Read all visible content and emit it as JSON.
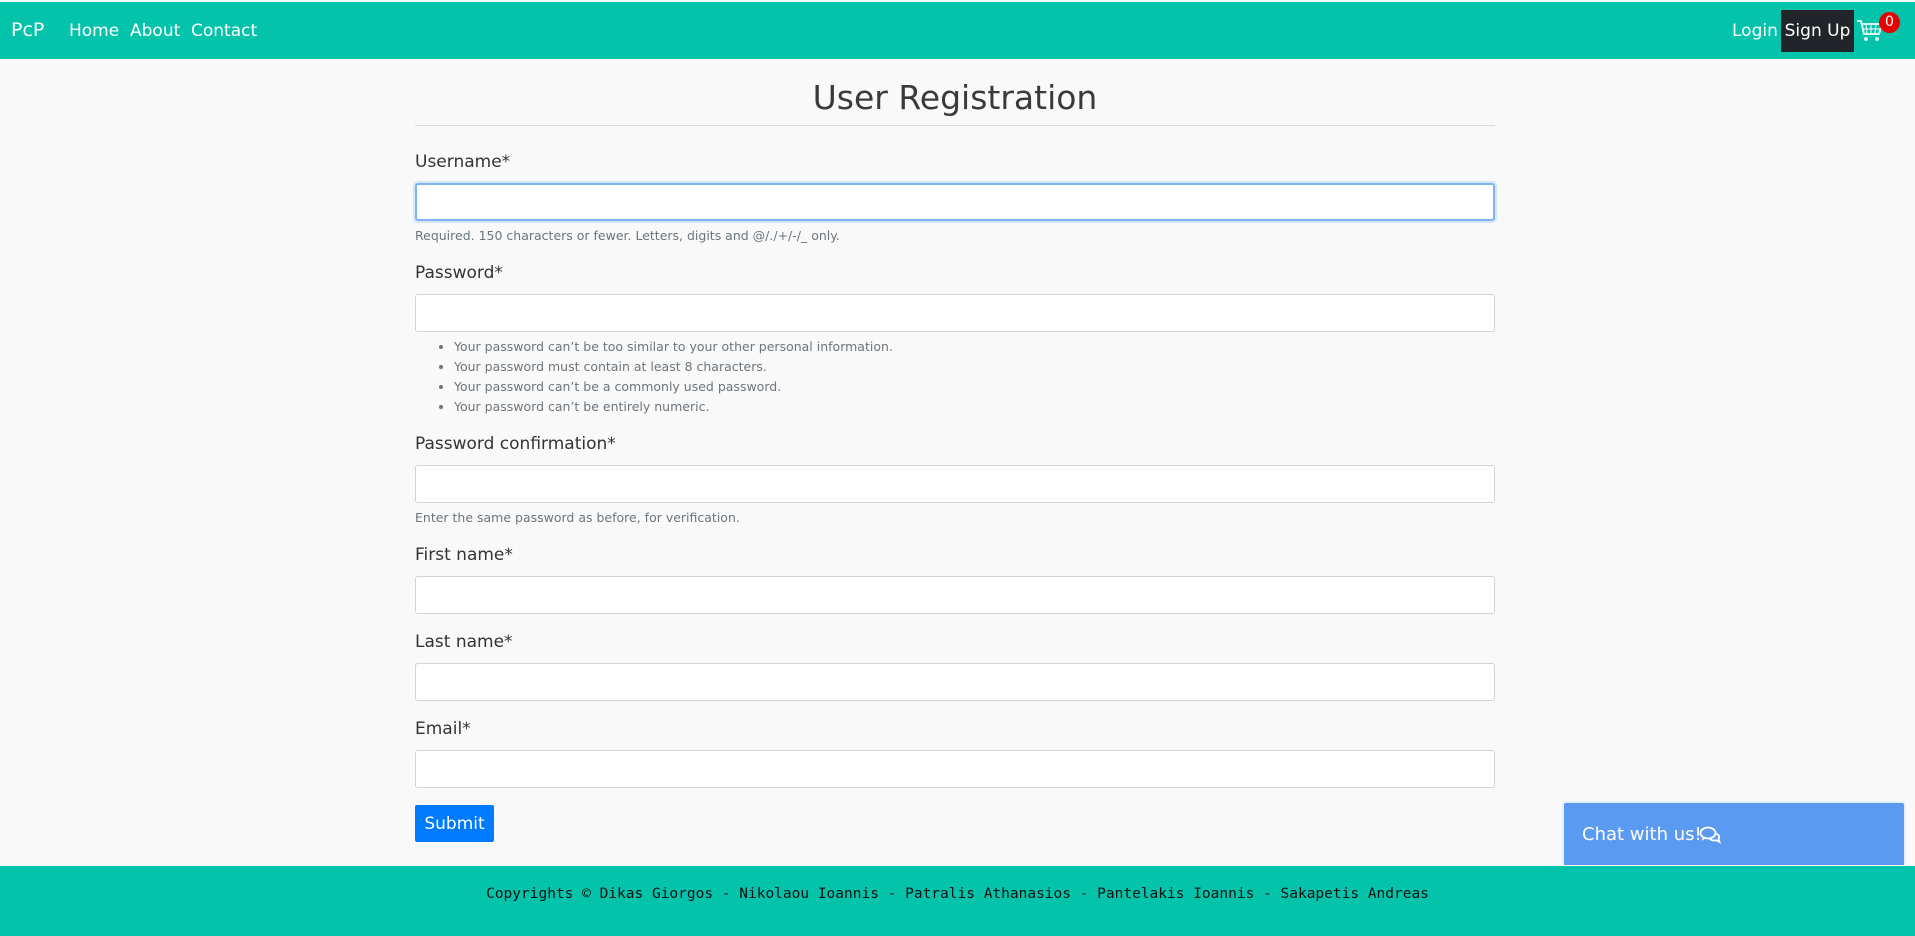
{
  "nav": {
    "brand": "PcP",
    "links": [
      "Home",
      "About",
      "Contact"
    ],
    "login": "Login",
    "signup": "Sign Up",
    "cart_count": "0",
    "accent": "#03c4aa"
  },
  "form": {
    "title": "User Registration",
    "username": {
      "label": "Username*",
      "value": "",
      "help": "Required. 150 characters or fewer. Letters, digits and @/./+/-/_ only."
    },
    "password": {
      "label": "Password*",
      "value": "",
      "rules": [
        "Your password can’t be too similar to your other personal information.",
        "Your password must contain at least 8 characters.",
        "Your password can’t be a commonly used password.",
        "Your password can’t be entirely numeric."
      ]
    },
    "password_confirmation": {
      "label": "Password confirmation*",
      "value": "",
      "help": "Enter the same password as before, for verification."
    },
    "first_name": {
      "label": "First name*",
      "value": ""
    },
    "last_name": {
      "label": "Last name*",
      "value": ""
    },
    "email": {
      "label": "Email*",
      "value": ""
    },
    "submit": "Submit"
  },
  "footer": {
    "text": "Copyrights © Dikas Giorgos - Nikolaou Ioannis - Patralis Athanasios - Pantelakis Ioannis - Sakapetis Andreas"
  },
  "chat": {
    "label": "Chat with us!",
    "icon": "chat-bubbles-icon"
  }
}
